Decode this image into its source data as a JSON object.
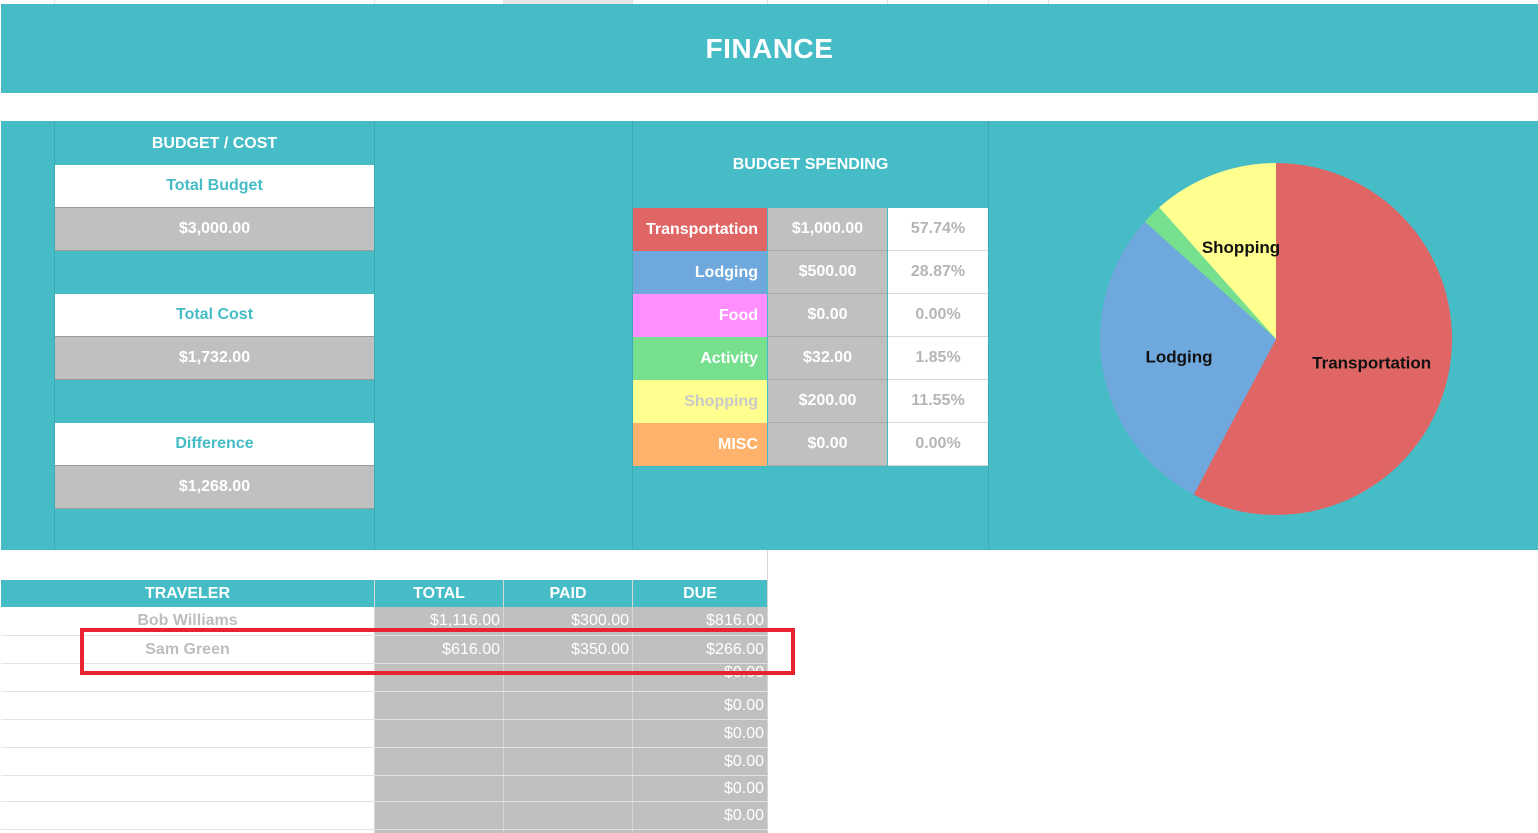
{
  "title": "FINANCE",
  "budget_cost": {
    "header": "BUDGET / COST",
    "total_budget_label": "Total Budget",
    "total_budget_value": "$3,000.00",
    "total_cost_label": "Total Cost",
    "total_cost_value": "$1,732.00",
    "difference_label": "Difference",
    "difference_value": "$1,268.00"
  },
  "spending": {
    "header": "BUDGET SPENDING",
    "rows": [
      {
        "category": "Transportation",
        "amount": "$1,000.00",
        "percent": "57.74%",
        "color": "#e06666"
      },
      {
        "category": "Lodging",
        "amount": "$500.00",
        "percent": "28.87%",
        "color": "#6fa8dc"
      },
      {
        "category": "Food",
        "amount": "$0.00",
        "percent": "0.00%",
        "color": "#ff8fff"
      },
      {
        "category": "Activity",
        "amount": "$32.00",
        "percent": "1.85%",
        "color": "#76e08f"
      },
      {
        "category": "Shopping",
        "amount": "$200.00",
        "percent": "11.55%",
        "color": "#ffff8f"
      },
      {
        "category": "MISC",
        "amount": "$0.00",
        "percent": "0.00%",
        "color": "#ffb26b"
      }
    ]
  },
  "chart_data": {
    "type": "pie",
    "slices": [
      {
        "label": "Transportation",
        "value": 1000,
        "color": "#e06666"
      },
      {
        "label": "Lodging",
        "value": 500,
        "color": "#6fa8dc"
      },
      {
        "label": "Food",
        "value": 0,
        "color": "#ff8fff"
      },
      {
        "label": "Activity",
        "value": 32,
        "color": "#76e08f"
      },
      {
        "label": "Shopping",
        "value": 200,
        "color": "#ffff8f"
      },
      {
        "label": "MISC",
        "value": 0,
        "color": "#ffb26b"
      }
    ],
    "labels_shown": [
      "Transportation",
      "Lodging",
      "Shopping"
    ]
  },
  "travelers": {
    "headers": {
      "traveler": "TRAVELER",
      "total": "TOTAL",
      "paid": "PAID",
      "due": "DUE"
    },
    "rows": [
      {
        "name": "Bob Williams",
        "total": "$1,116.00",
        "paid": "$300.00",
        "due": "$816.00"
      },
      {
        "name": "Sam Green",
        "total": "$616.00",
        "paid": "$350.00",
        "due": "$266.00"
      },
      {
        "name": "",
        "total": "",
        "paid": "",
        "due": "$0.00"
      },
      {
        "name": "",
        "total": "",
        "paid": "",
        "due": "$0.00"
      },
      {
        "name": "",
        "total": "",
        "paid": "",
        "due": "$0.00"
      },
      {
        "name": "",
        "total": "",
        "paid": "",
        "due": "$0.00"
      },
      {
        "name": "",
        "total": "",
        "paid": "",
        "due": "$0.00"
      },
      {
        "name": "",
        "total": "",
        "paid": "",
        "due": "$0.00"
      }
    ]
  },
  "highlight": {
    "target": "Sam Green",
    "color": "#e8232f"
  }
}
